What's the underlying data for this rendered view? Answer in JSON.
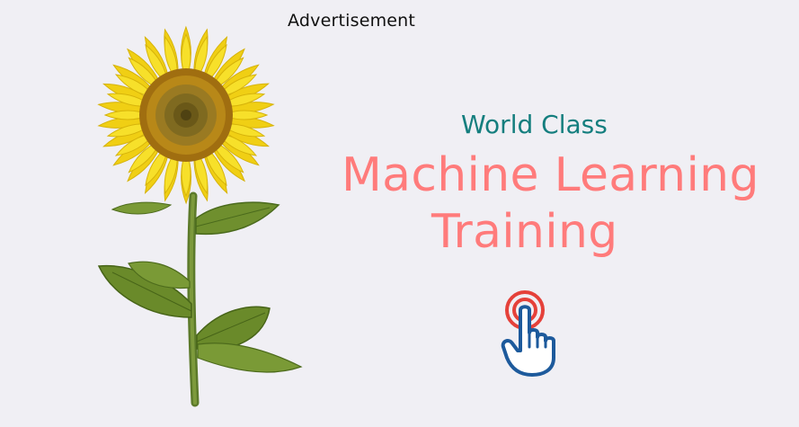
{
  "ad": {
    "label": "Advertisement"
  },
  "banner": {
    "tagline": "World Class",
    "headline_line1": "Machine Learning",
    "headline_line2": "Training",
    "image": "sunflower-illustration",
    "cta_icon": "tap-hand-icon"
  },
  "colors": {
    "background": "#f0eff4",
    "tagline": "#147e7e",
    "headline": "#ff7b7b",
    "icon_ring": "#e5413a",
    "icon_hand": "#1d5a9c"
  }
}
